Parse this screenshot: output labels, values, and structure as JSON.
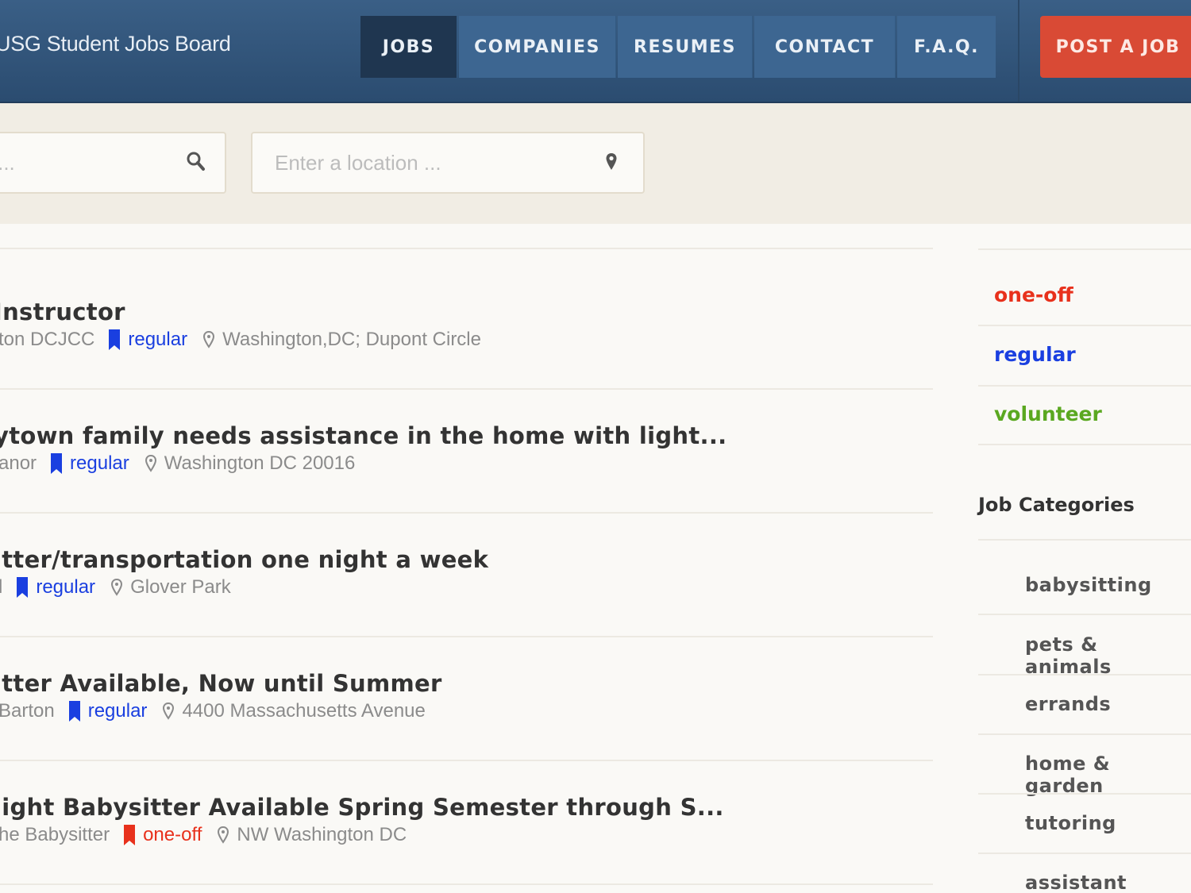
{
  "header": {
    "site_title": "USG Student Jobs Board",
    "nav": [
      "JOBS",
      "COMPANIES",
      "RESUMES",
      "CONTACT",
      "F.A.Q."
    ],
    "post_button": "POST A JOB"
  },
  "search": {
    "keyword_placeholder": "Enter a keyword ...",
    "location_placeholder": "Enter a location ..."
  },
  "jobs": [
    {
      "title": "Instructor",
      "company": "ton DCJCC",
      "type": "regular",
      "location": "Washington,DC; Dupont Circle"
    },
    {
      "title": "ytown family needs assistance in the home with light...",
      "company": "anor",
      "type": "regular",
      "location": "Washington DC 20016"
    },
    {
      "title": "itter/transportation one night a week",
      "company": "l",
      "type": "regular",
      "location": "Glover Park"
    },
    {
      "title": "itter Available, Now until Summer",
      "company": "Barton",
      "type": "regular",
      "location": "4400 Massachusetts Avenue"
    },
    {
      "title": "light Babysitter Available Spring Semester through S...",
      "company": "he Babysitter",
      "type": "one-off",
      "location": "NW Washington DC"
    }
  ],
  "sidebar": {
    "job_types": [
      {
        "label": "one-off",
        "color": "#e8311c"
      },
      {
        "label": "regular",
        "color": "#1a3fe0"
      },
      {
        "label": "volunteer",
        "color": "#5aa820"
      }
    ],
    "categories_heading": "Job Categories",
    "categories": [
      "babysitting",
      "pets & animals",
      "errands",
      "home & garden",
      "tutoring",
      "assistant"
    ]
  },
  "colors": {
    "header_bg": "#2f5378",
    "active_nav": "#1f3650",
    "post_button": "#d94a35",
    "regular": "#1a3fe0",
    "one_off": "#e8311c",
    "volunteer": "#5aa820"
  }
}
